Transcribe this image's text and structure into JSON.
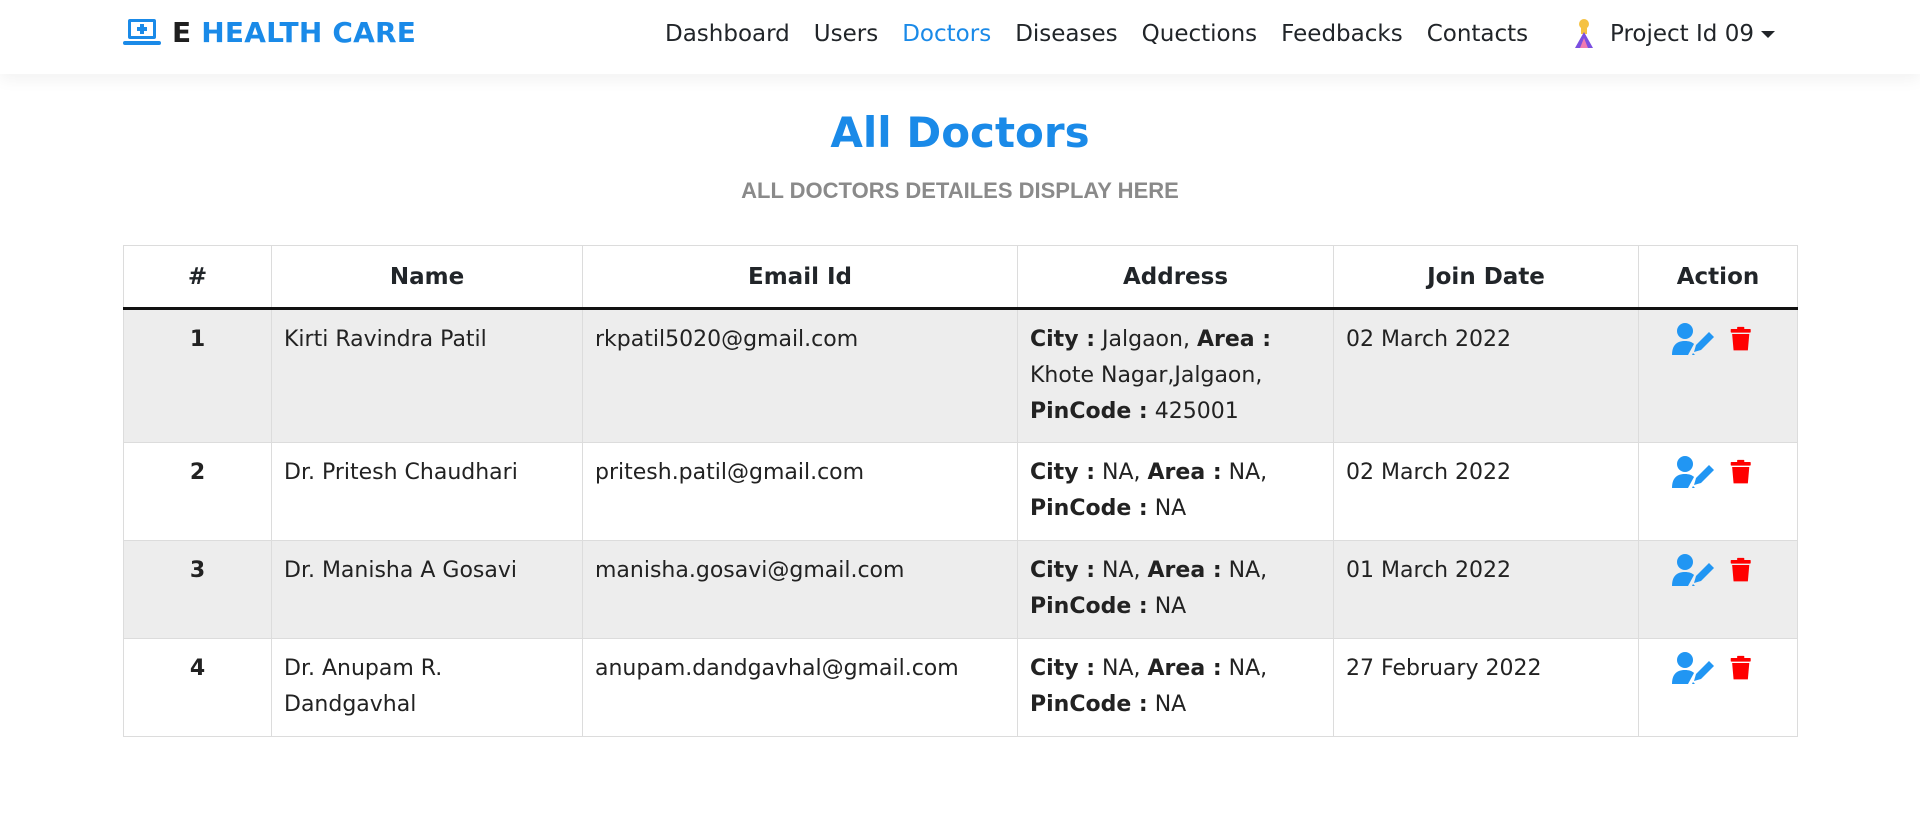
{
  "brand": {
    "prefix": "E",
    "name": "HEALTH CARE"
  },
  "nav": {
    "links": [
      "Dashboard",
      "Users",
      "Doctors",
      "Diseases",
      "Quections",
      "Feedbacks",
      "Contacts"
    ],
    "active": "Doctors",
    "user_label": "Project Id 09"
  },
  "header": {
    "title": "All Doctors",
    "subtitle": "ALL DOCTORS DETAILES DISPLAY HERE"
  },
  "table": {
    "columns": [
      "#",
      "Name",
      "Email Id",
      "Address",
      "Join Date",
      "Action"
    ],
    "address_labels": {
      "city": "City :",
      "area": "Area :",
      "pincode": "PinCode :"
    },
    "rows": [
      {
        "num": "1",
        "name": "Kirti Ravindra Patil",
        "email": "rkpatil5020@gmail.com",
        "city": "Jalgaon,",
        "area": "Khote Nagar,Jalgaon,",
        "pincode": "425001",
        "join": "02 March 2022"
      },
      {
        "num": "2",
        "name": "Dr. Pritesh Chaudhari",
        "email": "pritesh.patil@gmail.com",
        "city": "NA,",
        "area": "NA,",
        "pincode": "NA",
        "join": "02 March 2022"
      },
      {
        "num": "3",
        "name": "Dr. Manisha A Gosavi",
        "email": "manisha.gosavi@gmail.com",
        "city": "NA,",
        "area": "NA,",
        "pincode": "NA",
        "join": "01 March 2022"
      },
      {
        "num": "4",
        "name": "Dr. Anupam R. Dandgavhal",
        "email": "anupam.dandgavhal@gmail.com",
        "city": "NA,",
        "area": "NA,",
        "pincode": "NA",
        "join": "27 February 2022"
      }
    ]
  },
  "icons": {
    "brand": "laptop-medical-icon",
    "avatar": "user-avatar-icon",
    "edit": "user-edit-icon",
    "delete": "trash-icon"
  },
  "colors": {
    "accent": "#1a8ae8",
    "edit_icon": "#2196f3",
    "delete_icon": "#ff0000",
    "row_stripe": "#ededed",
    "subtitle": "#8a8a8a"
  }
}
